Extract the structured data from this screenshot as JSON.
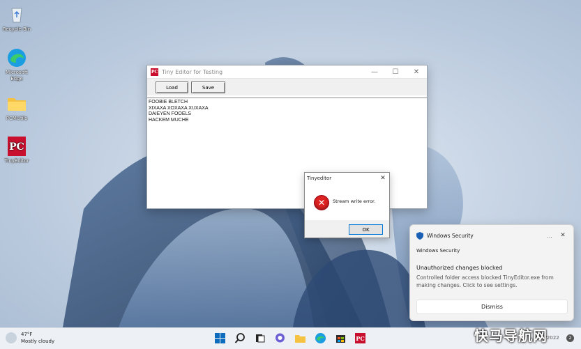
{
  "desktop": {
    "icons": [
      {
        "label": "Recycle Bin"
      },
      {
        "label": "Microsoft Edge"
      },
      {
        "label": "PCMUtils"
      },
      {
        "label": "TinyEditor"
      }
    ]
  },
  "editor_window": {
    "title": "Tiny Editor for Testing",
    "load_button": "Load",
    "save_button": "Save",
    "content": "FOOBIE BLETCH\nXIXAXA XOXAXA XUXAXA\nDAIEYEN FOOELS\nHACKEM MUCHE"
  },
  "error_dialog": {
    "title": "Tinyeditor",
    "message": "Stream write error.",
    "ok_button": "OK"
  },
  "toast": {
    "app_name": "Windows Security",
    "subtitle": "Windows Security",
    "heading": "Unauthorized changes blocked",
    "body": "Controlled folder access blocked TinyEditor.exe from making changes. Click to see settings.",
    "dismiss_button": "Dismiss",
    "more_label": "...",
    "close_label": "✕"
  },
  "taskbar": {
    "weather_temp": "47°F",
    "weather_desc": "Mostly cloudy",
    "date": "3/25/2022",
    "notification_count": "2"
  },
  "watermark": "快马导航网",
  "colors": {
    "accent": "#0078d7",
    "error_red": "#d22222",
    "pcmag_red": "#c8102e"
  }
}
